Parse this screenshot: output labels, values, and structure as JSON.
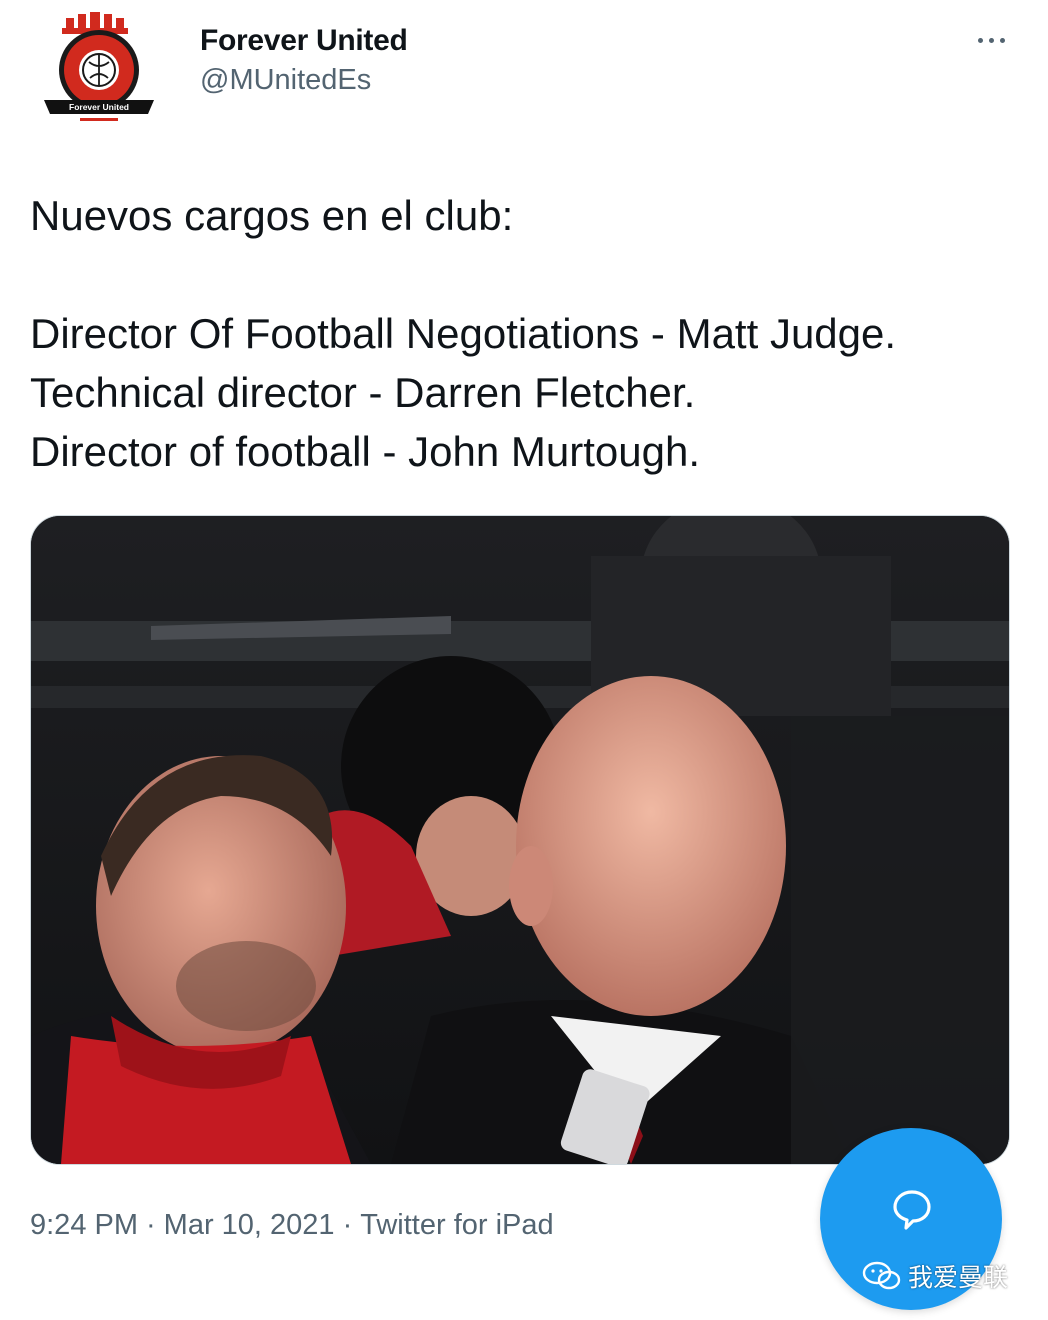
{
  "account": {
    "display_name": "Forever United",
    "handle": "@MUnitedEs",
    "avatar_icon": "forever-united-crest-icon",
    "avatar_text": "Forever United"
  },
  "tweet": {
    "text": "Nuevos cargos en el club:\n\nDirector Of Football Negotiations - Matt Judge.\nTechnical director - Darren Fletcher.\nDirector of football - John Murtough."
  },
  "media": {
    "type": "photo"
  },
  "meta": {
    "time": "9:24 PM",
    "date": "Mar 10, 2021",
    "source": "Twitter for iPad"
  },
  "actions": {
    "more_icon": "more-dots-icon",
    "compose_icon": "compose-reply-icon"
  },
  "watermark": {
    "text": "我爱曼联",
    "icon": "wechat-icon"
  },
  "colors": {
    "accent": "#1d9bf0",
    "secondary_text": "#536471",
    "primary_text": "#0f1419",
    "crest_red": "#d12a1e"
  }
}
